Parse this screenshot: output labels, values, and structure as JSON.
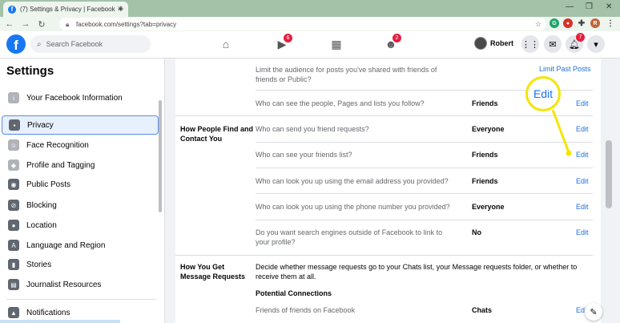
{
  "browser": {
    "tab_title": "(7) Settings & Privacy | Facebook",
    "url": "facebook.com/settings?tab=privacy",
    "profile_initial": "R"
  },
  "header": {
    "search_placeholder": "Search Facebook",
    "watch_badge": "6",
    "groups_badge": "2",
    "notifications_badge": "7",
    "profile_name": "Robert"
  },
  "sidebar": {
    "title": "Settings",
    "items": [
      {
        "label": "Your Facebook Information",
        "icon": "info-icon"
      },
      {
        "label": "Privacy",
        "icon": "lock-icon"
      },
      {
        "label": "Face Recognition",
        "icon": "face-icon"
      },
      {
        "label": "Profile and Tagging",
        "icon": "tag-icon"
      },
      {
        "label": "Public Posts",
        "icon": "globe-icon"
      },
      {
        "label": "Blocking",
        "icon": "block-icon"
      },
      {
        "label": "Location",
        "icon": "location-icon"
      },
      {
        "label": "Language and Region",
        "icon": "language-icon"
      },
      {
        "label": "Stories",
        "icon": "stories-icon"
      },
      {
        "label": "Journalist Resources",
        "icon": "news-icon"
      },
      {
        "label": "Notifications",
        "icon": "bell-icon"
      }
    ]
  },
  "content": {
    "rows": [
      {
        "question": "Limit the audience for posts you've shared with friends of friends or Public?",
        "value": "",
        "edit": "Limit Past Posts"
      },
      {
        "question": "Who can see the people, Pages and lists you follow?",
        "value": "Friends",
        "edit": "Edit"
      },
      {
        "question": "Who can send you friend requests?",
        "value": "Everyone",
        "edit": "Edit"
      },
      {
        "question": "Who can see your friends list?",
        "value": "Friends",
        "edit": "Edit"
      },
      {
        "question": "Who can look you up using the email address you provided?",
        "value": "Friends",
        "edit": "Edit"
      },
      {
        "question": "Who can look you up using the phone number you provided?",
        "value": "Everyone",
        "edit": "Edit"
      },
      {
        "question": "Do you want search engines outside of Facebook to link to your profile?",
        "value": "No",
        "edit": "Edit"
      },
      {
        "question": "Friends of friends on Facebook",
        "value": "Chats",
        "edit": "Edit"
      }
    ],
    "section_find": "How People Find and Contact You",
    "section_messages": "How You Get Message Requests",
    "messages_desc": "Decide whether message requests go to your Chats list, your Message requests folder, or whether to receive them at all.",
    "potential_connections": "Potential Connections"
  },
  "callout": {
    "label": "Edit"
  }
}
